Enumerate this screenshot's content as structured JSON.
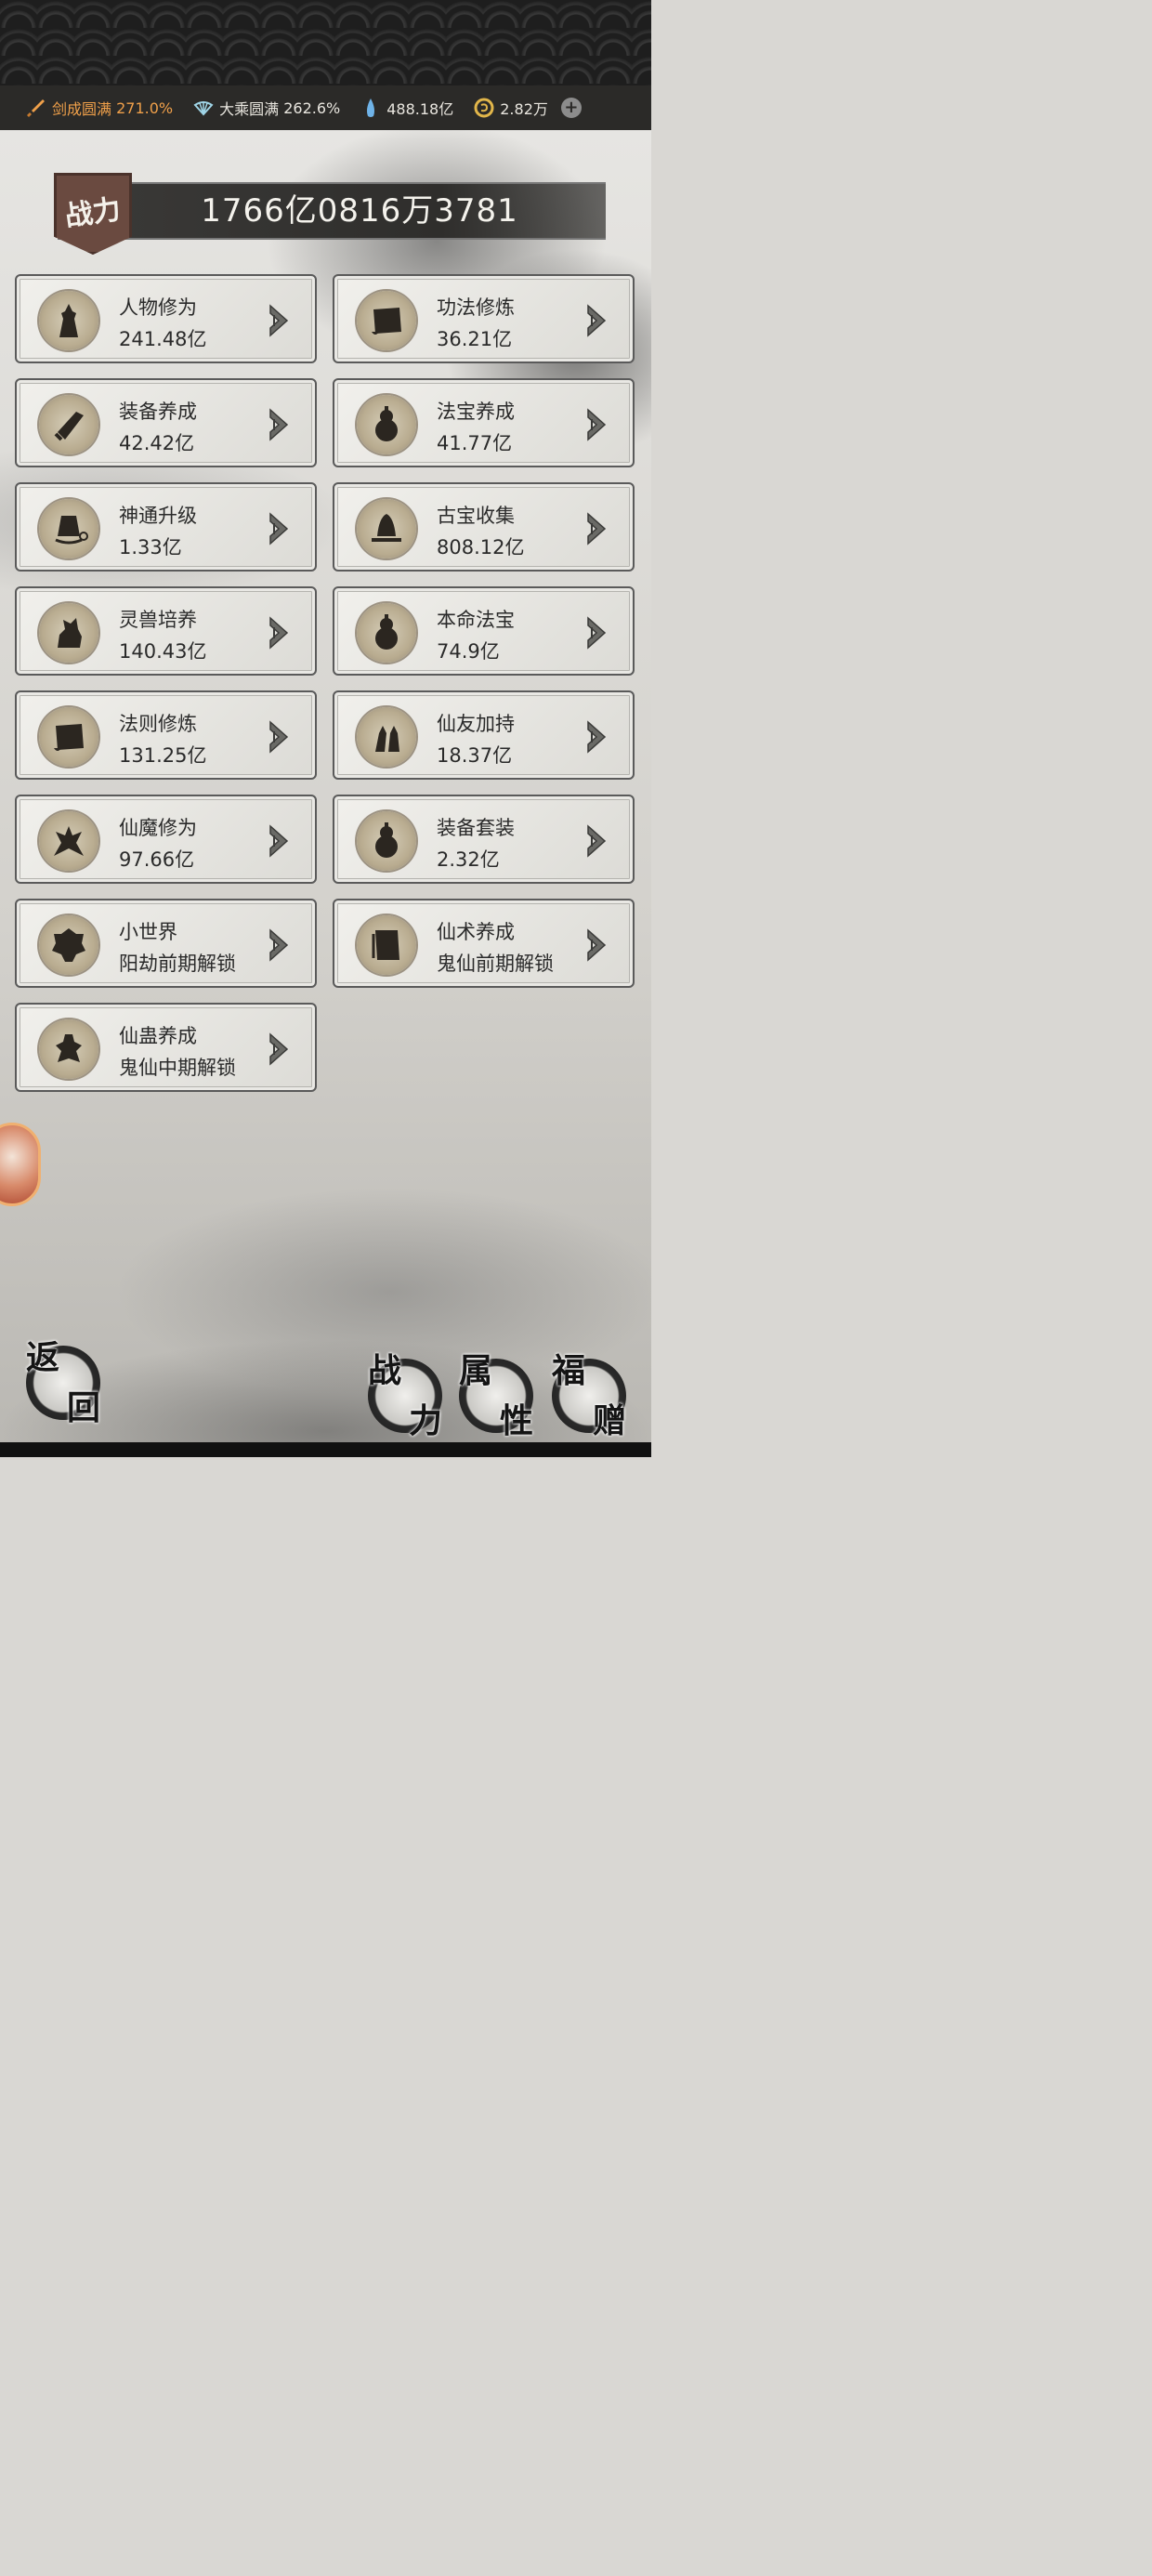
{
  "resources": {
    "realm1_label": "剑成圆满",
    "realm1_value": "271.0%",
    "realm2_label": "大乘圆满",
    "realm2_value": "262.6%",
    "spirit_stones": "488.18亿",
    "currency": "2.82万",
    "plus": "+"
  },
  "power": {
    "banner": "战力",
    "value": "1766亿0816万3781"
  },
  "cards": [
    {
      "title": "人物修为",
      "value": "241.48亿",
      "icon": "figure-icon"
    },
    {
      "title": "功法修炼",
      "value": "36.21亿",
      "icon": "scroll-icon"
    },
    {
      "title": "装备养成",
      "value": "42.42亿",
      "icon": "equipment-icon"
    },
    {
      "title": "法宝养成",
      "value": "41.77亿",
      "icon": "gourd-icon"
    },
    {
      "title": "神通升级",
      "value": "1.33亿",
      "icon": "bell-icon"
    },
    {
      "title": "古宝收集",
      "value": "808.12亿",
      "icon": "ancient-bell-icon"
    },
    {
      "title": "灵兽培养",
      "value": "140.43亿",
      "icon": "beast-icon"
    },
    {
      "title": "本命法宝",
      "value": "74.9亿",
      "icon": "gourd-icon"
    },
    {
      "title": "法则修炼",
      "value": "131.25亿",
      "icon": "scroll-icon"
    },
    {
      "title": "仙友加持",
      "value": "18.37亿",
      "icon": "companions-icon"
    },
    {
      "title": "仙魔修为",
      "value": "97.66亿",
      "icon": "demon-icon"
    },
    {
      "title": "装备套装",
      "value": "2.32亿",
      "icon": "gourd-icon"
    },
    {
      "title": "小世界",
      "value": "阳劫前期解锁",
      "icon": "world-icon"
    },
    {
      "title": "仙术养成",
      "value": "鬼仙前期解锁",
      "icon": "book-icon"
    },
    {
      "title": "仙蛊养成",
      "value": "鬼仙中期解锁",
      "icon": "gu-icon"
    }
  ],
  "nav": {
    "back": [
      "返",
      "回"
    ],
    "power": [
      "战",
      "力"
    ],
    "attributes": [
      "属",
      "性"
    ],
    "gifts": [
      "福",
      "赠"
    ]
  }
}
